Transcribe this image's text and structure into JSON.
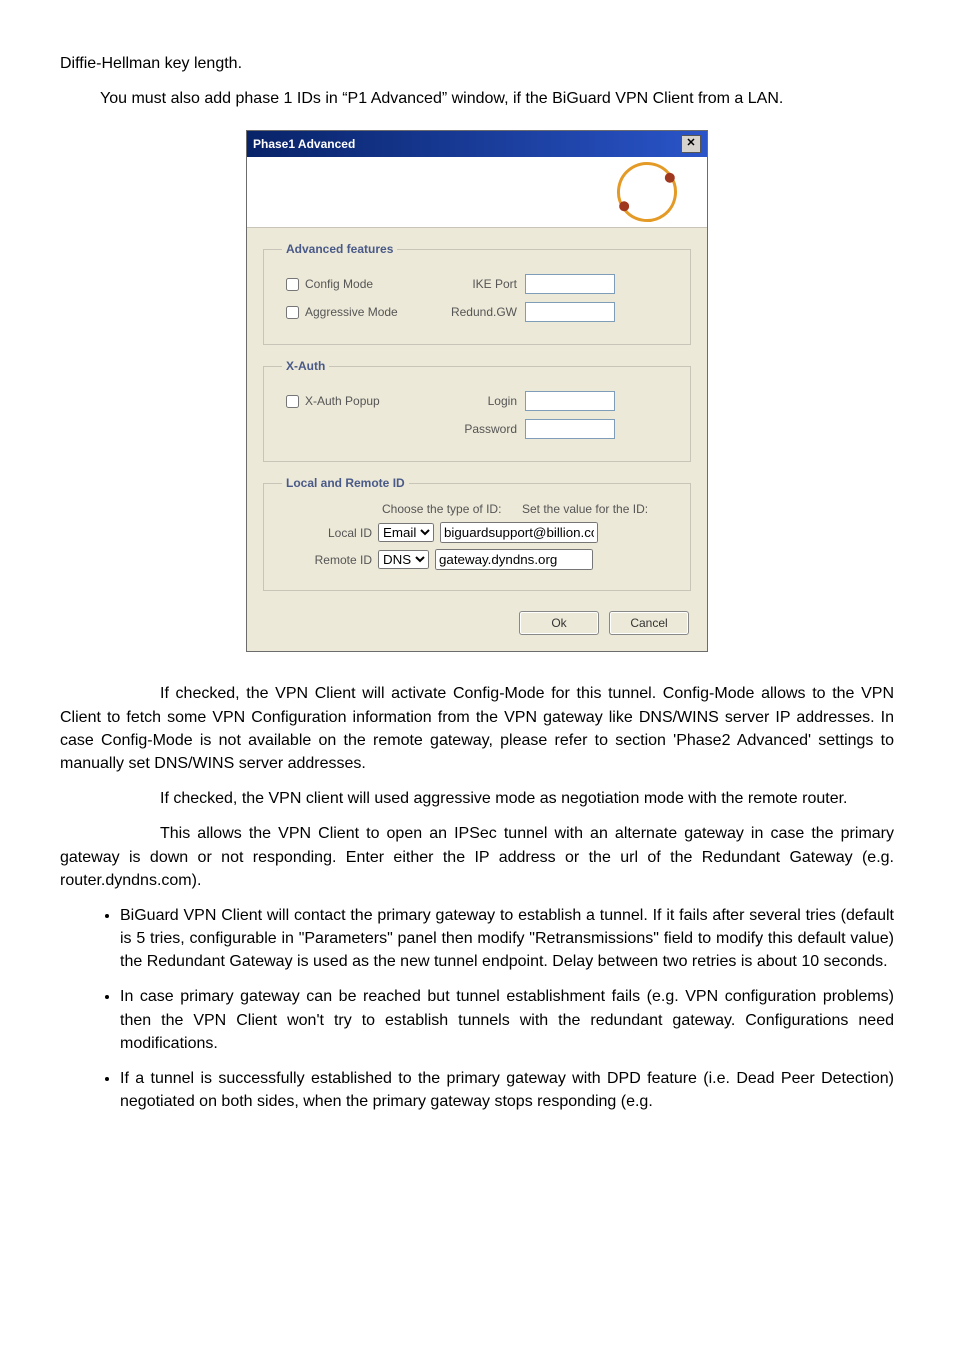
{
  "intro": {
    "line1": "Diffie-Hellman key length.",
    "line2": "You must also add phase 1 IDs in “P1 Advanced” window, if the BiGuard VPN Client from a LAN."
  },
  "dialog": {
    "title": "Phase1 Advanced",
    "close_glyph": "✕",
    "advanced": {
      "legend": "Advanced features",
      "config_mode": "Config Mode",
      "ike_port_label": "IKE Port",
      "ike_port_value": "",
      "aggressive_mode": "Aggressive Mode",
      "redund_gw_label": "Redund.GW",
      "redund_gw_value": ""
    },
    "xauth": {
      "legend": "X-Auth",
      "popup": "X-Auth Popup",
      "login_label": "Login",
      "login_value": "",
      "password_label": "Password",
      "password_value": ""
    },
    "ids": {
      "legend": "Local and Remote ID",
      "choose_header": "Choose the type of ID:",
      "set_header": "Set the value for the ID:",
      "local_label": "Local ID",
      "local_type": "Email",
      "local_value": "biguardsupport@billion.co",
      "remote_label": "Remote ID",
      "remote_type": "DNS",
      "remote_value": "gateway.dyndns.org"
    },
    "buttons": {
      "ok": "Ok",
      "cancel": "Cancel"
    }
  },
  "glossary": {
    "config_mode": "If checked, the VPN Client will activate Config-Mode for this tunnel. Config-Mode allows to the VPN Client to fetch some VPN Configuration information from the VPN gateway like DNS/WINS server IP addresses. In case Config-Mode is not available on the remote gateway, please refer to section 'Phase2 Advanced' settings to manually set DNS/WINS server addresses.",
    "aggressive": "If checked, the VPN client will used aggressive mode as negotiation mode with the remote router.",
    "redund": "This allows the VPN Client to open an IPSec tunnel with an alternate gateway in case the primary gateway is down or not responding. Enter either the IP address or the url of the Redundant Gateway (e.g. router.dyndns.com)."
  },
  "bullets": [
    "BiGuard VPN Client will contact the primary gateway to establish a tunnel. If it fails after several tries (default is 5 tries, configurable in \"Parameters\" panel then modify \"Retransmissions\" field to modify this default value) the Redundant Gateway is used as the new tunnel endpoint. Delay between two retries is about 10 seconds.",
    "In case primary gateway can be reached but tunnel establishment fails (e.g. VPN configuration problems) then the VPN Client won't try to establish tunnels with the redundant gateway. Configurations need modifications.",
    "If a tunnel is successfully established to the primary gateway with DPD feature (i.e. Dead Peer Detection) negotiated on both sides, when the primary gateway stops responding (e.g."
  ]
}
